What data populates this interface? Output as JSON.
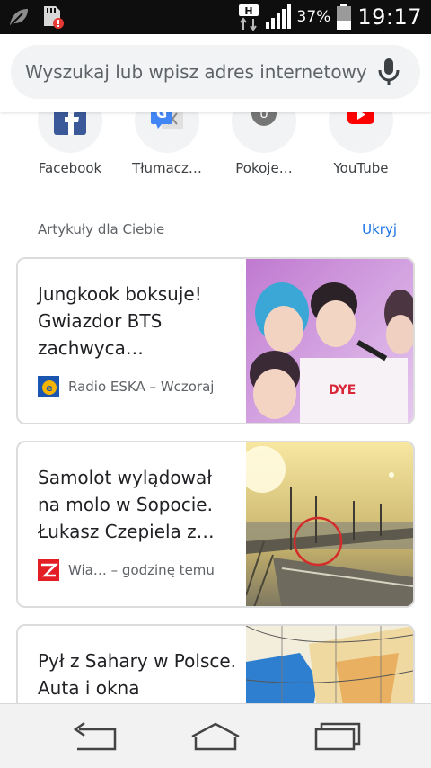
{
  "status_bar": {
    "network_type": "H",
    "battery_percent": "37%",
    "time": "19:17"
  },
  "omnibox": {
    "placeholder": "Wyszukaj lub wpisz adres internetowy"
  },
  "shortcuts": [
    {
      "label": "Facebook",
      "icon": "facebook-icon"
    },
    {
      "label": "Tłumacz…",
      "icon": "google-translate-icon"
    },
    {
      "label": "Pokoje…",
      "icon": "letter-u-icon",
      "letter": "U"
    },
    {
      "label": "YouTube",
      "icon": "youtube-icon"
    }
  ],
  "articles_section": {
    "title": "Artykuły dla Ciebie",
    "hide_label": "Ukryj"
  },
  "articles": [
    {
      "title": "Jungkook boksuje! Gwiazdor BTS zachwyca…",
      "source": "Radio ESKA",
      "time": "Wczoraj",
      "separator": " – "
    },
    {
      "title": "Samolot wylądował na molo w Sopocie. Łukasz Czepiela z…",
      "source": "Wia…",
      "time": "godzinę temu",
      "separator": " – "
    },
    {
      "title": "Pył z Sahary w Polsce. Auta i okna",
      "source": "",
      "time": "",
      "separator": ""
    }
  ],
  "colors": {
    "accent_link": "#1a73e8",
    "status_bar_bg": "#0e0e0e",
    "card_border": "#dcdcdc"
  }
}
